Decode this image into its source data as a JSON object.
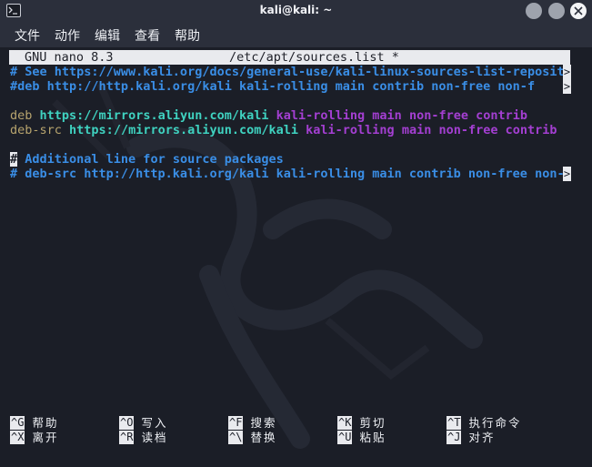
{
  "window": {
    "title": "kali@kali: ~",
    "icon": "terminal-icon"
  },
  "menu": [
    "文件",
    "动作",
    "编辑",
    "查看",
    "帮助"
  ],
  "nano": {
    "version": "GNU nano 8.3",
    "filename": "/etc/apt/sources.list *"
  },
  "lines": {
    "l0": "# See https://www.kali.org/docs/general-use/kali-linux-sources-list-reposito",
    "l1": "#deb http://http.kali.org/kali kali-rolling main contrib non-free non-f",
    "l3": {
      "kw": "deb",
      "url": "https://mirrors.aliyun.com/kali",
      "dist": "kali-rolling main non-free contrib"
    },
    "l4": {
      "kw": "deb-src",
      "url": "https://mirrors.aliyun.com/kali",
      "dist": "kali-rolling main non-free contrib"
    },
    "l6_cursor": "#",
    "l6_rest": " Additional line for source packages",
    "l7": "# deb-src http://http.kali.org/kali kali-rolling main contrib non-free non-f"
  },
  "truncation_marker": ">",
  "shortcuts": [
    {
      "key": "^G",
      "label": "帮助"
    },
    {
      "key": "^O",
      "label": "写入"
    },
    {
      "key": "^F",
      "label": "搜索"
    },
    {
      "key": "^K",
      "label": "剪切"
    },
    {
      "key": "^T",
      "label": "执行命令"
    },
    {
      "key": "^X",
      "label": "离开"
    },
    {
      "key": "^R",
      "label": "读档"
    },
    {
      "key": "^\\",
      "label": "替换"
    },
    {
      "key": "^U",
      "label": "粘贴"
    },
    {
      "key": "^J",
      "label": "对齐"
    }
  ],
  "colors": {
    "background": "#1b1e27",
    "chrome": "#2b2f3b",
    "comment": "#3a8ee6",
    "keyword": "#b7a46e",
    "url": "#3fd2c0",
    "distribution": "#a43fd2"
  }
}
